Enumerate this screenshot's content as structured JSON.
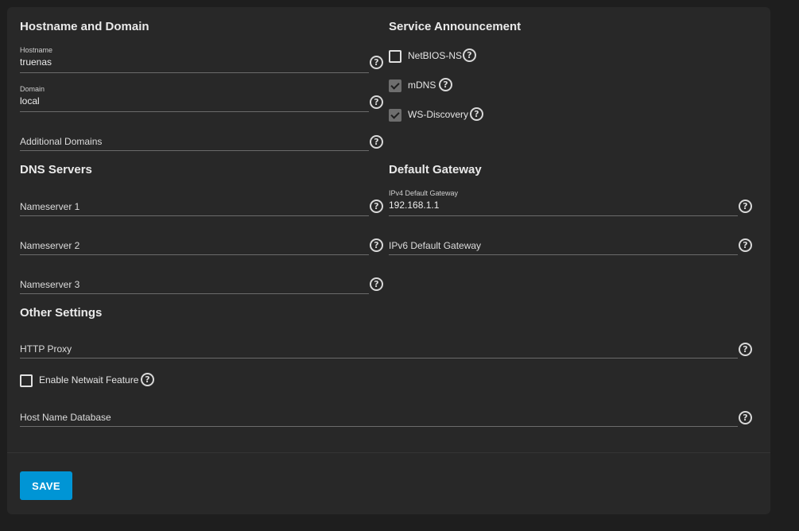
{
  "sections": {
    "hostname_domain": "Hostname and Domain",
    "service_announcement": "Service Announcement",
    "dns_servers": "DNS Servers",
    "default_gateway": "Default Gateway",
    "other_settings": "Other Settings"
  },
  "fields": {
    "hostname": {
      "label": "Hostname",
      "value": "truenas"
    },
    "domain": {
      "label": "Domain",
      "value": "local"
    },
    "additional_domains": {
      "placeholder": "Additional Domains"
    },
    "nameserver1": {
      "placeholder": "Nameserver 1"
    },
    "nameserver2": {
      "placeholder": "Nameserver 2"
    },
    "nameserver3": {
      "placeholder": "Nameserver 3"
    },
    "ipv4_gateway": {
      "label": "IPv4 Default Gateway",
      "value": "192.168.1.1"
    },
    "ipv6_gateway": {
      "placeholder": "IPv6 Default Gateway"
    },
    "http_proxy": {
      "placeholder": "HTTP Proxy"
    },
    "host_name_database": {
      "placeholder": "Host Name Database"
    }
  },
  "checkboxes": {
    "netbios": {
      "label": "NetBIOS-NS",
      "checked": false
    },
    "mdns": {
      "label": "mDNS",
      "checked": true
    },
    "ws_discovery": {
      "label": "WS-Discovery",
      "checked": true
    },
    "netwait": {
      "label": "Enable Netwait Feature",
      "checked": false
    }
  },
  "help_icon_glyph": "?",
  "actions": {
    "save_label": "SAVE"
  },
  "colors": {
    "accent": "#0095d5",
    "background": "#1e1e1e",
    "card": "#282828"
  }
}
